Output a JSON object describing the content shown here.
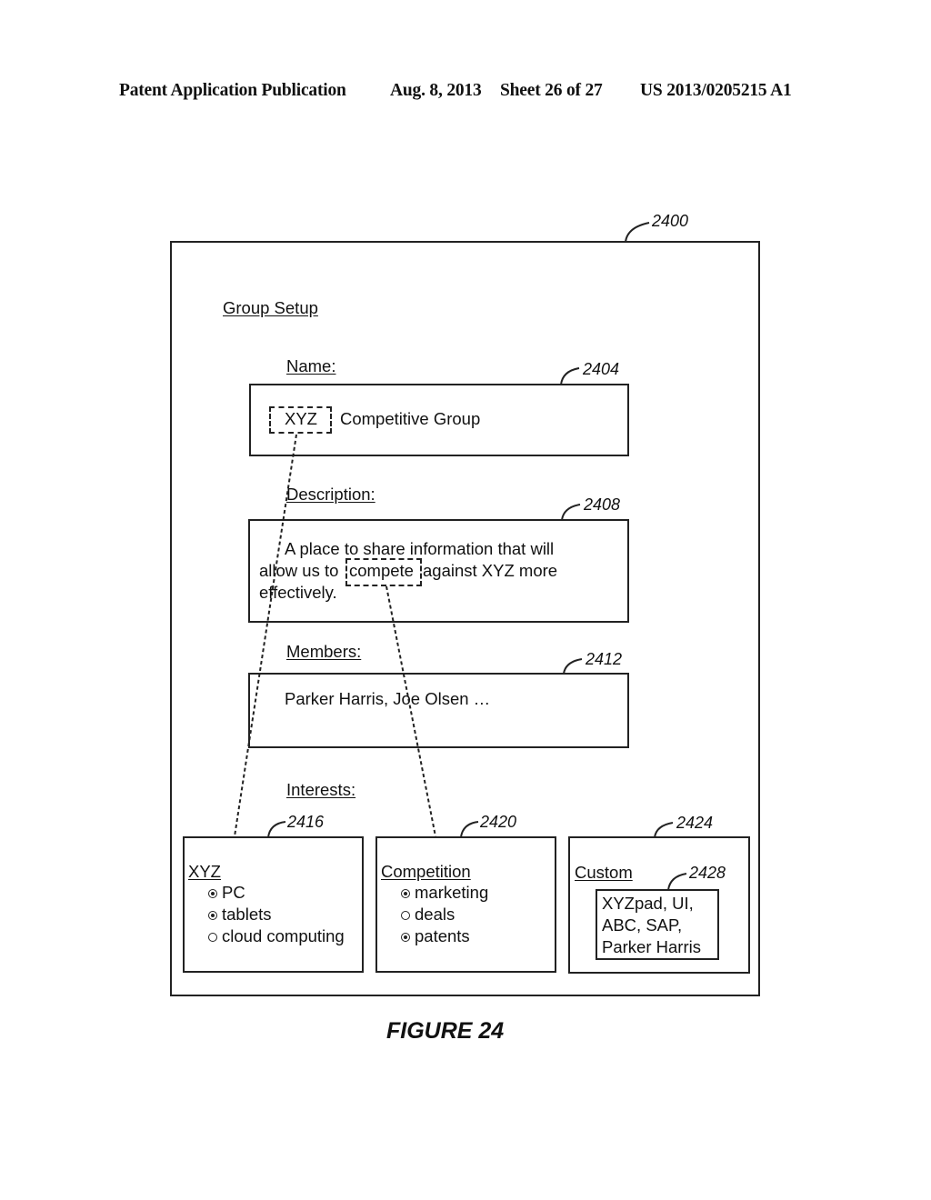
{
  "header": {
    "publication": "Patent Application Publication",
    "date": "Aug. 8, 2013",
    "sheet": "Sheet 26 of 27",
    "number": "US 2013/0205215 A1"
  },
  "figure": {
    "ref": "2400",
    "title": "Group Setup",
    "caption": "FIGURE 24"
  },
  "name_field": {
    "label": "Name:",
    "ref": "2404",
    "highlight": "XYZ",
    "value": "Competitive Group"
  },
  "description_field": {
    "label": "Description:",
    "ref": "2408",
    "line1": "A place to share information that will",
    "line2_pre": "allow us to",
    "line2_highlight": "compete",
    "line2_post": "against XYZ more",
    "line3": "effectively."
  },
  "members_field": {
    "label": "Members:",
    "ref": "2412",
    "value": "Parker Harris, Joe Olsen …"
  },
  "interests": {
    "label": "Interests:",
    "groups": [
      {
        "ref": "2416",
        "title": "XYZ",
        "options": [
          {
            "label": "PC",
            "selected": true
          },
          {
            "label": "tablets",
            "selected": true
          },
          {
            "label": "cloud computing",
            "selected": false
          }
        ]
      },
      {
        "ref": "2420",
        "title": "Competition",
        "options": [
          {
            "label": "marketing",
            "selected": true
          },
          {
            "label": "deals",
            "selected": false
          },
          {
            "label": "patents",
            "selected": true
          }
        ]
      },
      {
        "ref": "2424",
        "title": "Custom",
        "custom_ref": "2428",
        "custom_lines": [
          "XYZpad, UI,",
          "ABC, SAP,",
          "Parker Harris"
        ]
      }
    ]
  }
}
